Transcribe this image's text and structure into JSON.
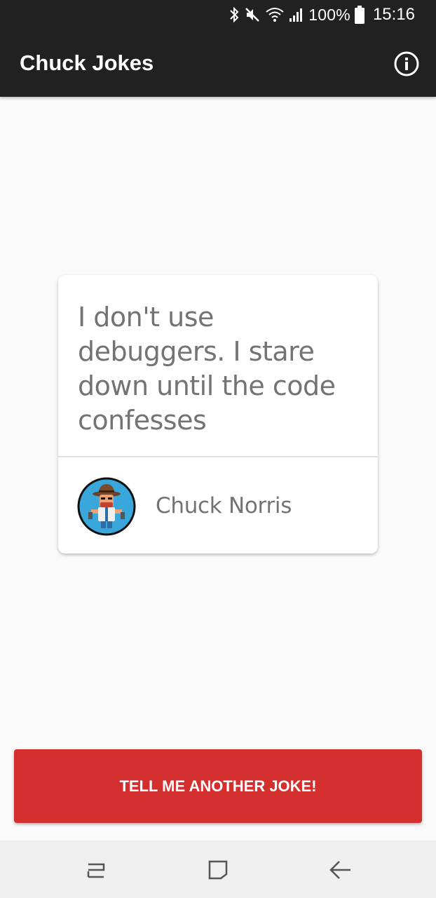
{
  "status_bar": {
    "battery": "100%",
    "time": "15:16"
  },
  "app_bar": {
    "title": "Chuck Jokes",
    "info_icon": "info-icon"
  },
  "card": {
    "joke": "I don't use debuggers. I stare down until the code confesses",
    "author": "Chuck Norris",
    "avatar_icon": "chuck-norris-avatar"
  },
  "button": {
    "label": "TELL ME ANOTHER JOKE!"
  },
  "nav_bar": {
    "icons": [
      "recent-apps-icon",
      "home-icon",
      "back-icon"
    ]
  },
  "colors": {
    "app_bar": "#212121",
    "accent_button": "#d32f2f",
    "background": "#fafafa",
    "text": "#737373"
  }
}
